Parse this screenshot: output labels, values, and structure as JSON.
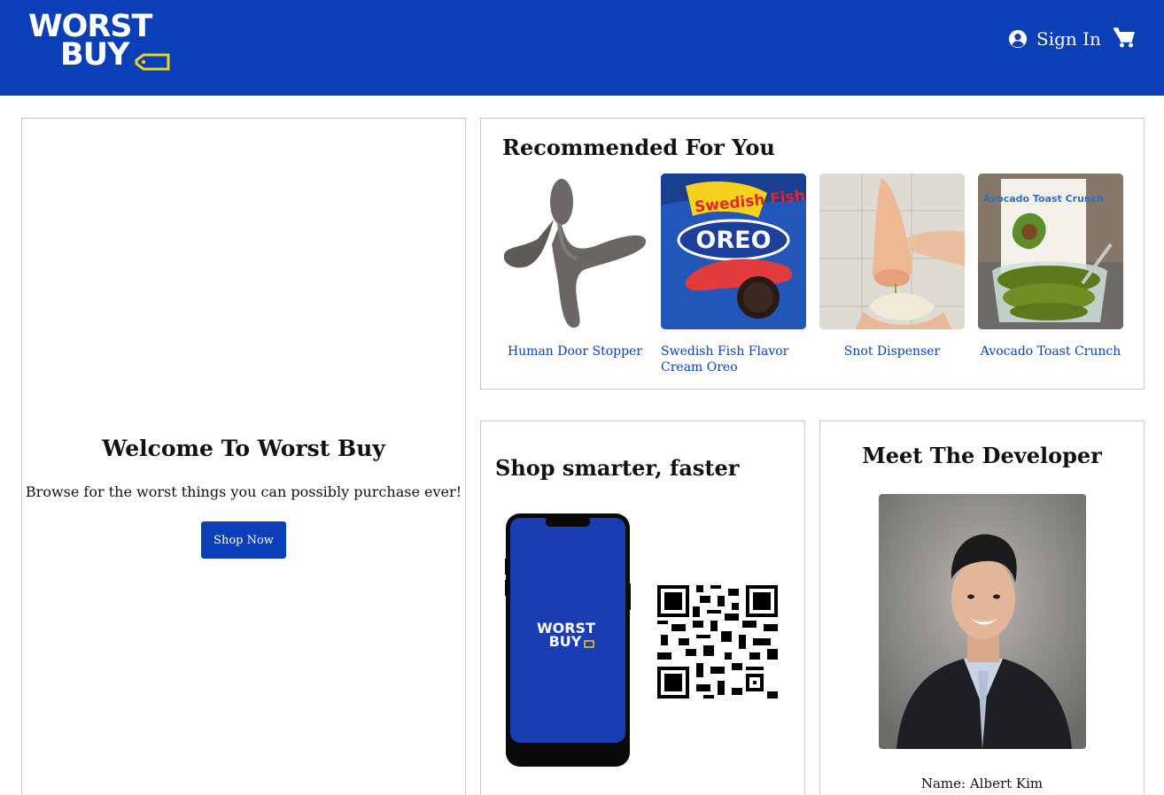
{
  "header": {
    "logo_line1": "WORST",
    "logo_line2": "BUY",
    "signin_label": "Sign In",
    "icons": {
      "signin": "user-circle-icon",
      "cart": "shopping-cart-icon"
    },
    "bg_color": "#0a3fb8",
    "tag_color": "#f2d21b"
  },
  "welcome": {
    "title": "Welcome To Worst Buy",
    "subtitle": "Browse for the worst things you can possibly purchase ever!",
    "button_label": "Shop Now"
  },
  "recommended": {
    "title": "Recommended For You",
    "items": [
      {
        "label": "Human Door Stopper"
      },
      {
        "label": "Swedish Fish Flavor Cream Oreo"
      },
      {
        "label": "Snot Dispenser"
      },
      {
        "label": "Avocado Toast Crunch"
      }
    ]
  },
  "app_promo": {
    "title": "Shop smarter, faster",
    "phone_logo_line1": "WORST",
    "phone_logo_line2": "BUY"
  },
  "developer": {
    "title": "Meet The Developer",
    "name": "Name: Albert Kim"
  },
  "product_art": {
    "oreo_brand": "OREO",
    "swedish_fish_brand": "Swedish Fish",
    "cereal_brand": "Avocado Toast Crunch"
  }
}
